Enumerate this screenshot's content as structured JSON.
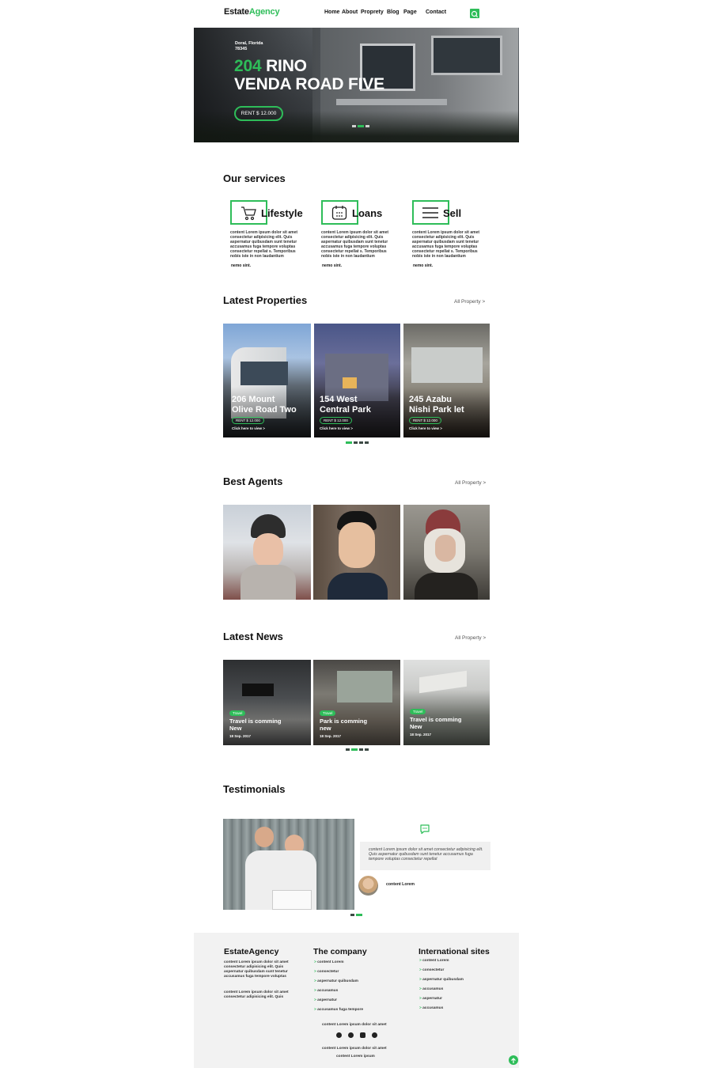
{
  "header": {
    "logo_a": "Estate",
    "logo_b": "Agency",
    "nav": [
      "Home",
      "About",
      "Proprety",
      "Blog",
      "Page",
      "Contact"
    ]
  },
  "hero": {
    "loc1": "Doral, Florida",
    "loc2": "78345",
    "num": "204",
    "line1": " RINO",
    "line2": "VENDA ROAD FIVE",
    "rent": "RENT $ 12.000"
  },
  "services": {
    "title": "Our services",
    "items": [
      {
        "name": "Lifestyle",
        "icon": "cart-icon",
        "text": "content Lorem ipsum dolor sit amet consectetur adipisicing elit. Quis aspernatur quibusdam sunt tenetur accusamus fuga tempore voluptas consectetur repellat s. Temporibus nobis iste in non laudantium",
        "more": "nemo sint."
      },
      {
        "name": "Loans",
        "icon": "calendar-icon",
        "text": "content Lorem ipsum dolor sit amet consectetur adipisicing elit. Quis aspernatur quibusdam sunt tenetur accusamus fuga tempore voluptas consectetur repellat s. Temporibus nobis iste in non laudantium",
        "more": "nemo sint."
      },
      {
        "name": "Sell",
        "icon": "menu-icon",
        "text": "content Lorem ipsum dolor sit amet consectetur adipisicing elit. Quis aspernatur quibusdam sunt tenetur accusamus fuga tempore voluptas consectetur repellat s. Temporibus nobis iste in non laudantium",
        "more": "nemo sint."
      }
    ]
  },
  "properties": {
    "title": "Latest Properties",
    "link": "All Property  >",
    "items": [
      {
        "l1": "206 Mount",
        "l2": "Olive Road Two",
        "rent": "RENT $ 12.000",
        "cta": "Click here to view >"
      },
      {
        "l1": "154 West",
        "l2": "Central Park",
        "rent": "RENT $ 12.000",
        "cta": "Click here to view >"
      },
      {
        "l1": "245 Azabu",
        "l2": "Nishi Park let",
        "rent": "RENT $ 12.000",
        "cta": "Click here to view >"
      }
    ]
  },
  "agents": {
    "title": "Best Agents",
    "link": "All Property  >"
  },
  "news": {
    "title": "Latest News",
    "link": "All Property  >",
    "items": [
      {
        "tag": "Travel",
        "t1": "Travel is comming",
        "t2": "New",
        "date": "18 Sep. 2017"
      },
      {
        "tag": "Travel",
        "t1": "Park is comming",
        "t2": "new",
        "date": "18 Sep. 2017"
      },
      {
        "tag": "Travel",
        "t1": "Travel is comming",
        "t2": "New",
        "date": "18 Sep. 2017"
      }
    ]
  },
  "testimonials": {
    "title": "Testimonials",
    "quote": "content Lorem ipsum dolor sit amet consectetur adipisicing elit. Quis aspernatur quibusdam sunt tenetur accusamus fuga tempore voluptas consectetur repellat",
    "author": "content Lorem"
  },
  "footer": {
    "brand": "EstateAgency",
    "brand_p1": "content Lorem ipsum dolor sit amet consectetur adipisicing elit. Quis aspernatur quibusdam sunt tenetur accusamus fuga tempore voluptas",
    "brand_p2": "content Lorem ipsum dolor sit amet consectetur adipisicing elit. Quis",
    "company": "The company",
    "company_links": [
      "content Lorem",
      "consectetur",
      "aspernatur quibusdam",
      "accusamus",
      "aspernatur",
      "accusamus fuga tempore"
    ],
    "intl": "International sites",
    "intl_links": [
      "content Lorem",
      "consectetur",
      "aspernatur quibusdam",
      "accusamus",
      "aspernatur",
      "accusamus"
    ],
    "bottom1": "content Lorem ipsum dolor sit amet",
    "bottom2": "content Lorem ipsum dolor sit amet",
    "bottom3": "content Lorem ipsum"
  },
  "colors": {
    "accent": "#2ebd59",
    "footer_bg": "#f2f2f2"
  }
}
